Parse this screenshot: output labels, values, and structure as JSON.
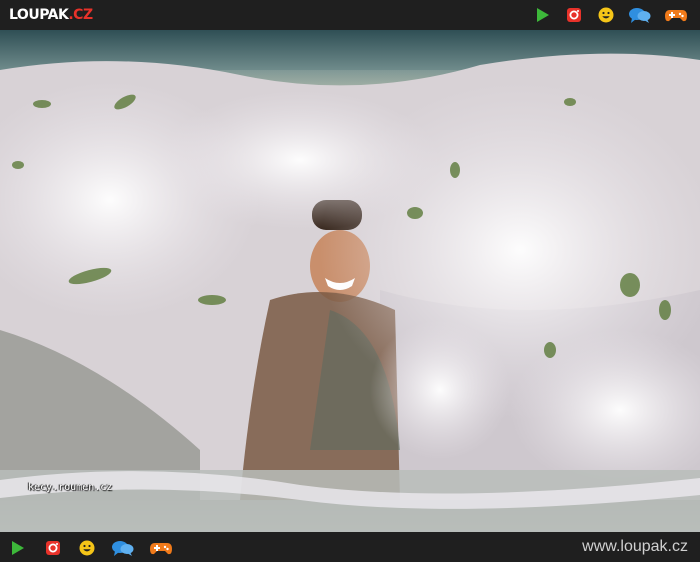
{
  "header": {
    "logo_main": "LOUPAK",
    "logo_suffix": ".CZ",
    "icons": [
      "play-icon",
      "instagram-icon",
      "smiley-icon",
      "chat-icon",
      "gamepad-icon"
    ]
  },
  "photo": {
    "watermark": "kecy.roumen.cz"
  },
  "footer": {
    "icons": [
      "play-icon",
      "instagram-icon",
      "smiley-icon",
      "chat-icon",
      "gamepad-icon"
    ],
    "site_url": "www.loupak.cz"
  },
  "colors": {
    "bar_bg": "#1f1f1f",
    "play_green": "#3db83a",
    "instagram_red": "#e8322a",
    "smiley_yellow": "#f5c518",
    "chat_blue": "#2f8fe0",
    "gamepad_orange": "#f07a1a"
  }
}
